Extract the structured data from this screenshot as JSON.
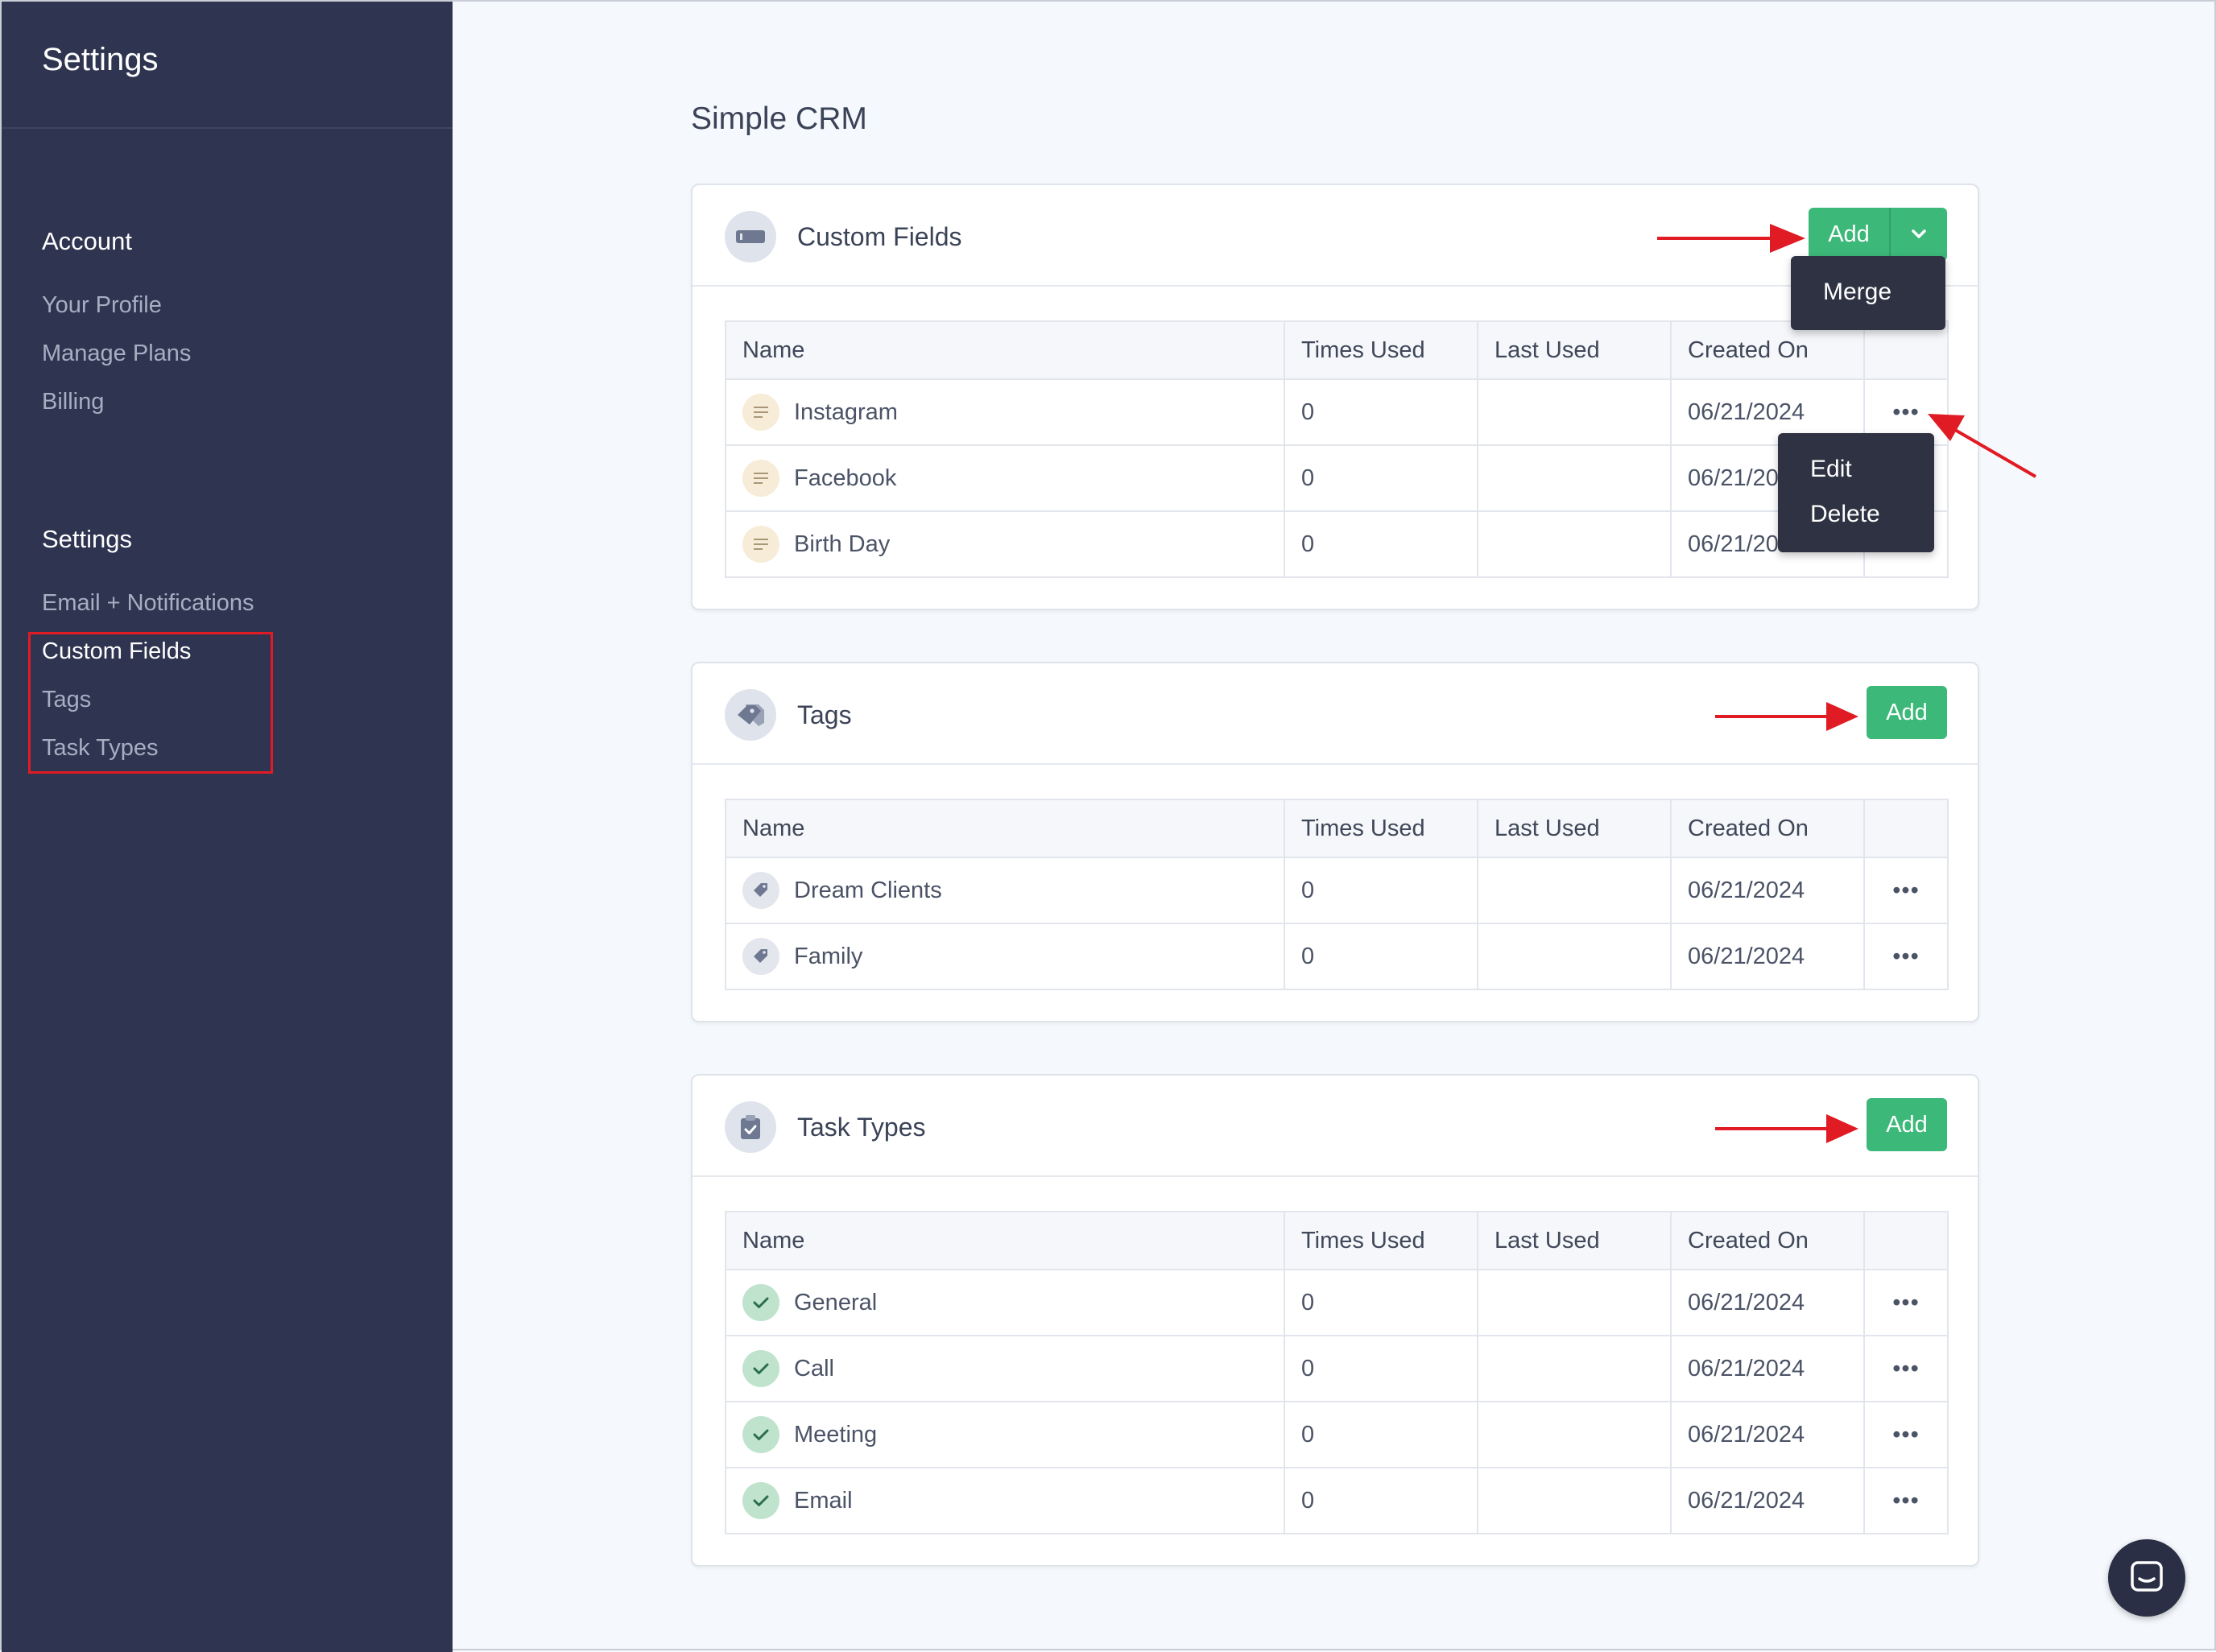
{
  "sidebar": {
    "title": "Settings",
    "account_heading": "Account",
    "account_links": [
      "Your Profile",
      "Manage Plans",
      "Billing"
    ],
    "settings_heading": "Settings",
    "settings_links": [
      "Email + Notifications",
      "Custom Fields",
      "Tags",
      "Task Types"
    ],
    "active_link": "Custom Fields"
  },
  "page": {
    "title": "Simple CRM"
  },
  "columns": [
    "Name",
    "Times Used",
    "Last Used",
    "Created On",
    ""
  ],
  "custom_fields": {
    "title": "Custom Fields",
    "add_label": "Add",
    "split_menu": [
      "Merge"
    ],
    "row_menu": [
      "Edit",
      "Delete"
    ],
    "rows": [
      {
        "name": "Instagram",
        "times_used": "0",
        "last_used": "",
        "created_on": "06/21/2024"
      },
      {
        "name": "Facebook",
        "times_used": "0",
        "last_used": "",
        "created_on": "06/21/2024"
      },
      {
        "name": "Birth Day",
        "times_used": "0",
        "last_used": "",
        "created_on": "06/21/2024"
      }
    ]
  },
  "tags": {
    "title": "Tags",
    "add_label": "Add",
    "rows": [
      {
        "name": "Dream Clients",
        "times_used": "0",
        "last_used": "",
        "created_on": "06/21/2024"
      },
      {
        "name": "Family",
        "times_used": "0",
        "last_used": "",
        "created_on": "06/21/2024"
      }
    ]
  },
  "task_types": {
    "title": "Task Types",
    "add_label": "Add",
    "rows": [
      {
        "name": "General",
        "times_used": "0",
        "last_used": "",
        "created_on": "06/21/2024"
      },
      {
        "name": "Call",
        "times_used": "0",
        "last_used": "",
        "created_on": "06/21/2024"
      },
      {
        "name": "Meeting",
        "times_used": "0",
        "last_used": "",
        "created_on": "06/21/2024"
      },
      {
        "name": "Email",
        "times_used": "0",
        "last_used": "",
        "created_on": "06/21/2024"
      }
    ]
  },
  "row_actions_label": "•••",
  "colors": {
    "sidebar_bg": "#2f3450",
    "accent_green": "#3cb879",
    "annotation_red": "#e01b24",
    "menu_bg": "#2f3242"
  },
  "icons": {
    "custom_fields_card": "input-field-icon",
    "tags_card": "tags-icon",
    "task_types_card": "task-clipboard-icon",
    "custom_field_row": "text-lines-icon",
    "tag_row": "tag-icon",
    "task_type_row": "check-icon",
    "chat": "chat-bubble-icon"
  }
}
